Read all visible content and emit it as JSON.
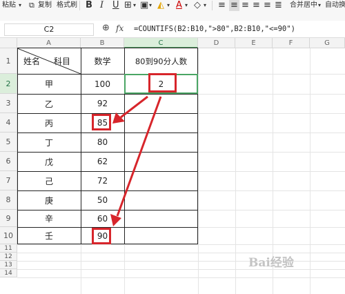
{
  "toolbar": {
    "paste_label": "粘贴",
    "copy_label": "复制",
    "format_painter_label": "格式刷",
    "bold_icon": "B",
    "italic_icon": "I",
    "underline_icon": "U",
    "merge_center_label": "合并居中",
    "auto_wrap_label": "自动换"
  },
  "formula_bar": {
    "cell_ref": "C2",
    "fx_label": "fx",
    "formula": "=COUNTIFS(B2:B10,\">80\",B2:B10,\"<=90\")"
  },
  "columns": [
    "A",
    "B",
    "C",
    "D",
    "E",
    "F",
    "G"
  ],
  "rows": [
    "1",
    "2",
    "3",
    "4",
    "5",
    "6",
    "7",
    "8",
    "9",
    "10",
    "11",
    "12",
    "13",
    "14"
  ],
  "table": {
    "header_name": "姓名",
    "header_subject": "科目",
    "header_score": "数学",
    "header_count": "80到90分人数",
    "names": [
      "甲",
      "乙",
      "丙",
      "丁",
      "戊",
      "己",
      "庚",
      "辛",
      "壬"
    ],
    "scores": [
      "100",
      "92",
      "85",
      "80",
      "62",
      "72",
      "50",
      "60",
      "90"
    ],
    "result": "2"
  },
  "watermark": "Bai经验",
  "colors": {
    "selection_green": "#4aa564",
    "annotation_red": "#d7252b"
  }
}
